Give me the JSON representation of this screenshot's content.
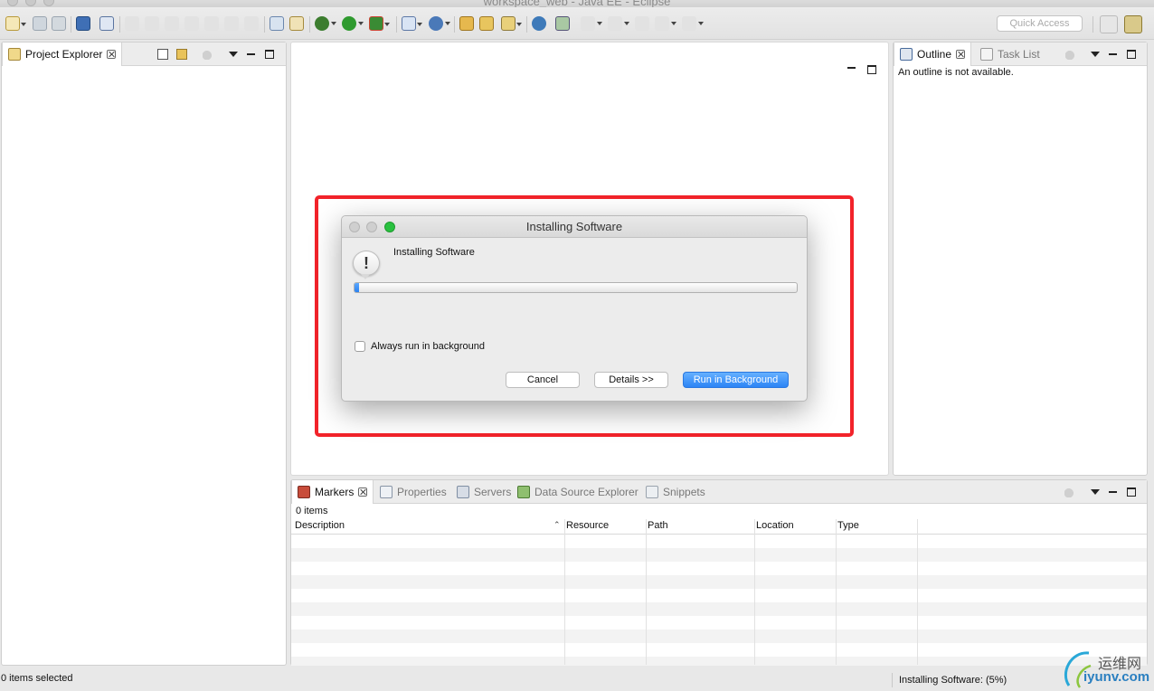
{
  "window": {
    "title": "workspace_web - Java EE - Eclipse"
  },
  "toolbar": {
    "quick_access_placeholder": "Quick Access"
  },
  "project_explorer": {
    "tab_label": "Project Explorer"
  },
  "outline": {
    "tab_label": "Outline",
    "task_list_label": "Task List",
    "message": "An outline is not available."
  },
  "dialog": {
    "title": "Installing Software",
    "message": "Installing Software",
    "progress_percent": 1,
    "checkbox_label": "Always run in background",
    "cancel_label": "Cancel",
    "details_label": "Details >>",
    "run_bg_label": "Run in Background"
  },
  "bottom": {
    "tabs": [
      "Markers",
      "Properties",
      "Servers",
      "Data Source Explorer",
      "Snippets"
    ],
    "item_count": "0 items",
    "columns": [
      "Description",
      "Resource",
      "Path",
      "Location",
      "Type"
    ]
  },
  "status": {
    "left": "0 items selected",
    "right": "Installing Software: (5%)"
  },
  "watermark": {
    "cn": "运维网",
    "url": "iyunv.com"
  },
  "colors": {
    "accent": "#2c84f5",
    "highlight": "#f2232a"
  }
}
